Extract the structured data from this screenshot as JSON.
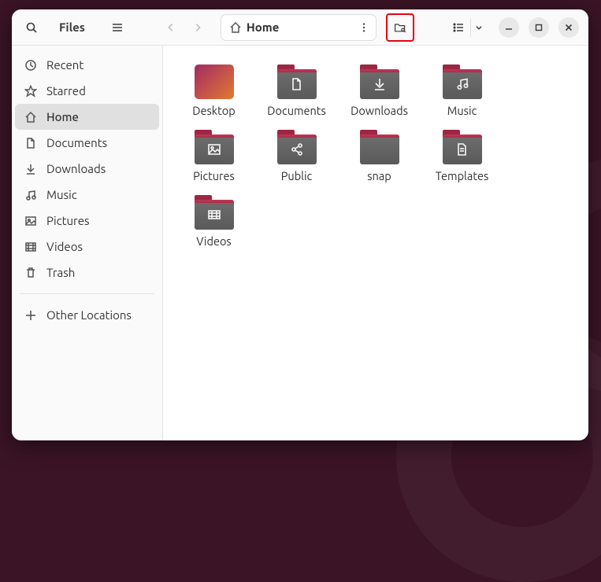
{
  "app": {
    "title": "Files"
  },
  "path": {
    "current": "Home"
  },
  "sidebar": {
    "items": [
      {
        "label": "Recent",
        "icon": "clock",
        "active": false
      },
      {
        "label": "Starred",
        "icon": "star",
        "active": false
      },
      {
        "label": "Home",
        "icon": "home",
        "active": true
      },
      {
        "label": "Documents",
        "icon": "document",
        "active": false
      },
      {
        "label": "Downloads",
        "icon": "download",
        "active": false
      },
      {
        "label": "Music",
        "icon": "music",
        "active": false
      },
      {
        "label": "Pictures",
        "icon": "picture",
        "active": false
      },
      {
        "label": "Videos",
        "icon": "video",
        "active": false
      },
      {
        "label": "Trash",
        "icon": "trash",
        "active": false
      }
    ],
    "other": {
      "label": "Other Locations"
    }
  },
  "folders": [
    {
      "name": "Desktop",
      "icon": "desktop"
    },
    {
      "name": "Documents",
      "icon": "document"
    },
    {
      "name": "Downloads",
      "icon": "download"
    },
    {
      "name": "Music",
      "icon": "music"
    },
    {
      "name": "Pictures",
      "icon": "picture"
    },
    {
      "name": "Public",
      "icon": "share"
    },
    {
      "name": "snap",
      "icon": "plain"
    },
    {
      "name": "Templates",
      "icon": "template"
    },
    {
      "name": "Videos",
      "icon": "video"
    }
  ],
  "highlight": "folder-search-button"
}
